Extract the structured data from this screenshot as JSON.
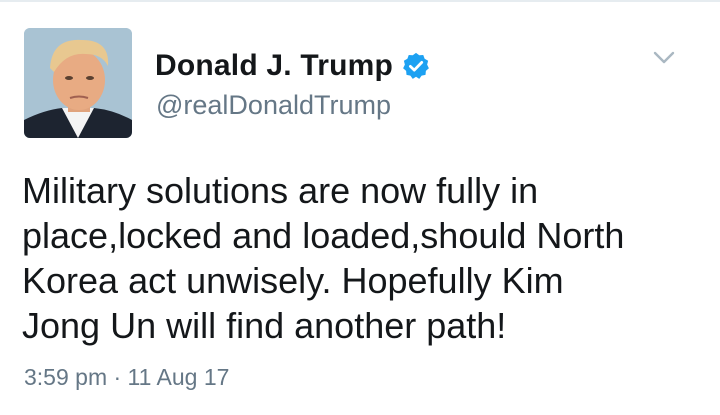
{
  "tweet": {
    "display_name": "Donald J. Trump",
    "handle": "@realDonaldTrump",
    "text": "Military solutions are now fully in\nplace,locked and loaded,should North\nKorea act unwisely.  Hopefully Kim\nJong Un will find another path!",
    "timestamp": "3:59 pm · 11 Aug 17"
  },
  "icons": {
    "verified": "verified-badge-icon",
    "menu": "chevron-down-icon"
  },
  "colors": {
    "verified_blue": "#1da1f2",
    "text": "#14171a",
    "secondary_text": "#657786"
  }
}
